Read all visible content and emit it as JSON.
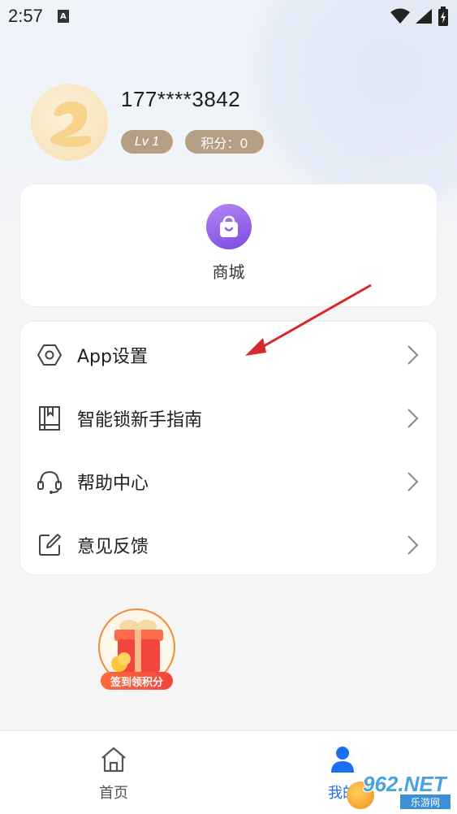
{
  "status_bar": {
    "time": "2:57",
    "notification_icon": "a-icon",
    "icons": [
      "wifi-icon",
      "signal-icon",
      "battery-charging-icon"
    ]
  },
  "profile": {
    "phone": "177****3842",
    "level": "Lv 1",
    "points": "积分：0"
  },
  "shop": {
    "label": "商城",
    "icon": "shopping-bag-icon",
    "color": "#8b5cf0"
  },
  "menu": {
    "items": [
      {
        "label": "App设置",
        "icon": "settings-hexagon-icon"
      },
      {
        "label": "智能锁新手指南",
        "icon": "book-icon"
      },
      {
        "label": "帮助中心",
        "icon": "headset-icon"
      },
      {
        "label": "意见反馈",
        "icon": "edit-icon"
      }
    ]
  },
  "checkin": {
    "label": "签到领积分",
    "icon": "gift-box-icon"
  },
  "tabbar": {
    "home_label": "首页",
    "mine_label": "我的",
    "active_color": "#1c6ef0"
  },
  "watermark": {
    "main": "962.NET",
    "sub": "乐游网"
  },
  "annotation": {
    "color": "#d42a2a"
  }
}
